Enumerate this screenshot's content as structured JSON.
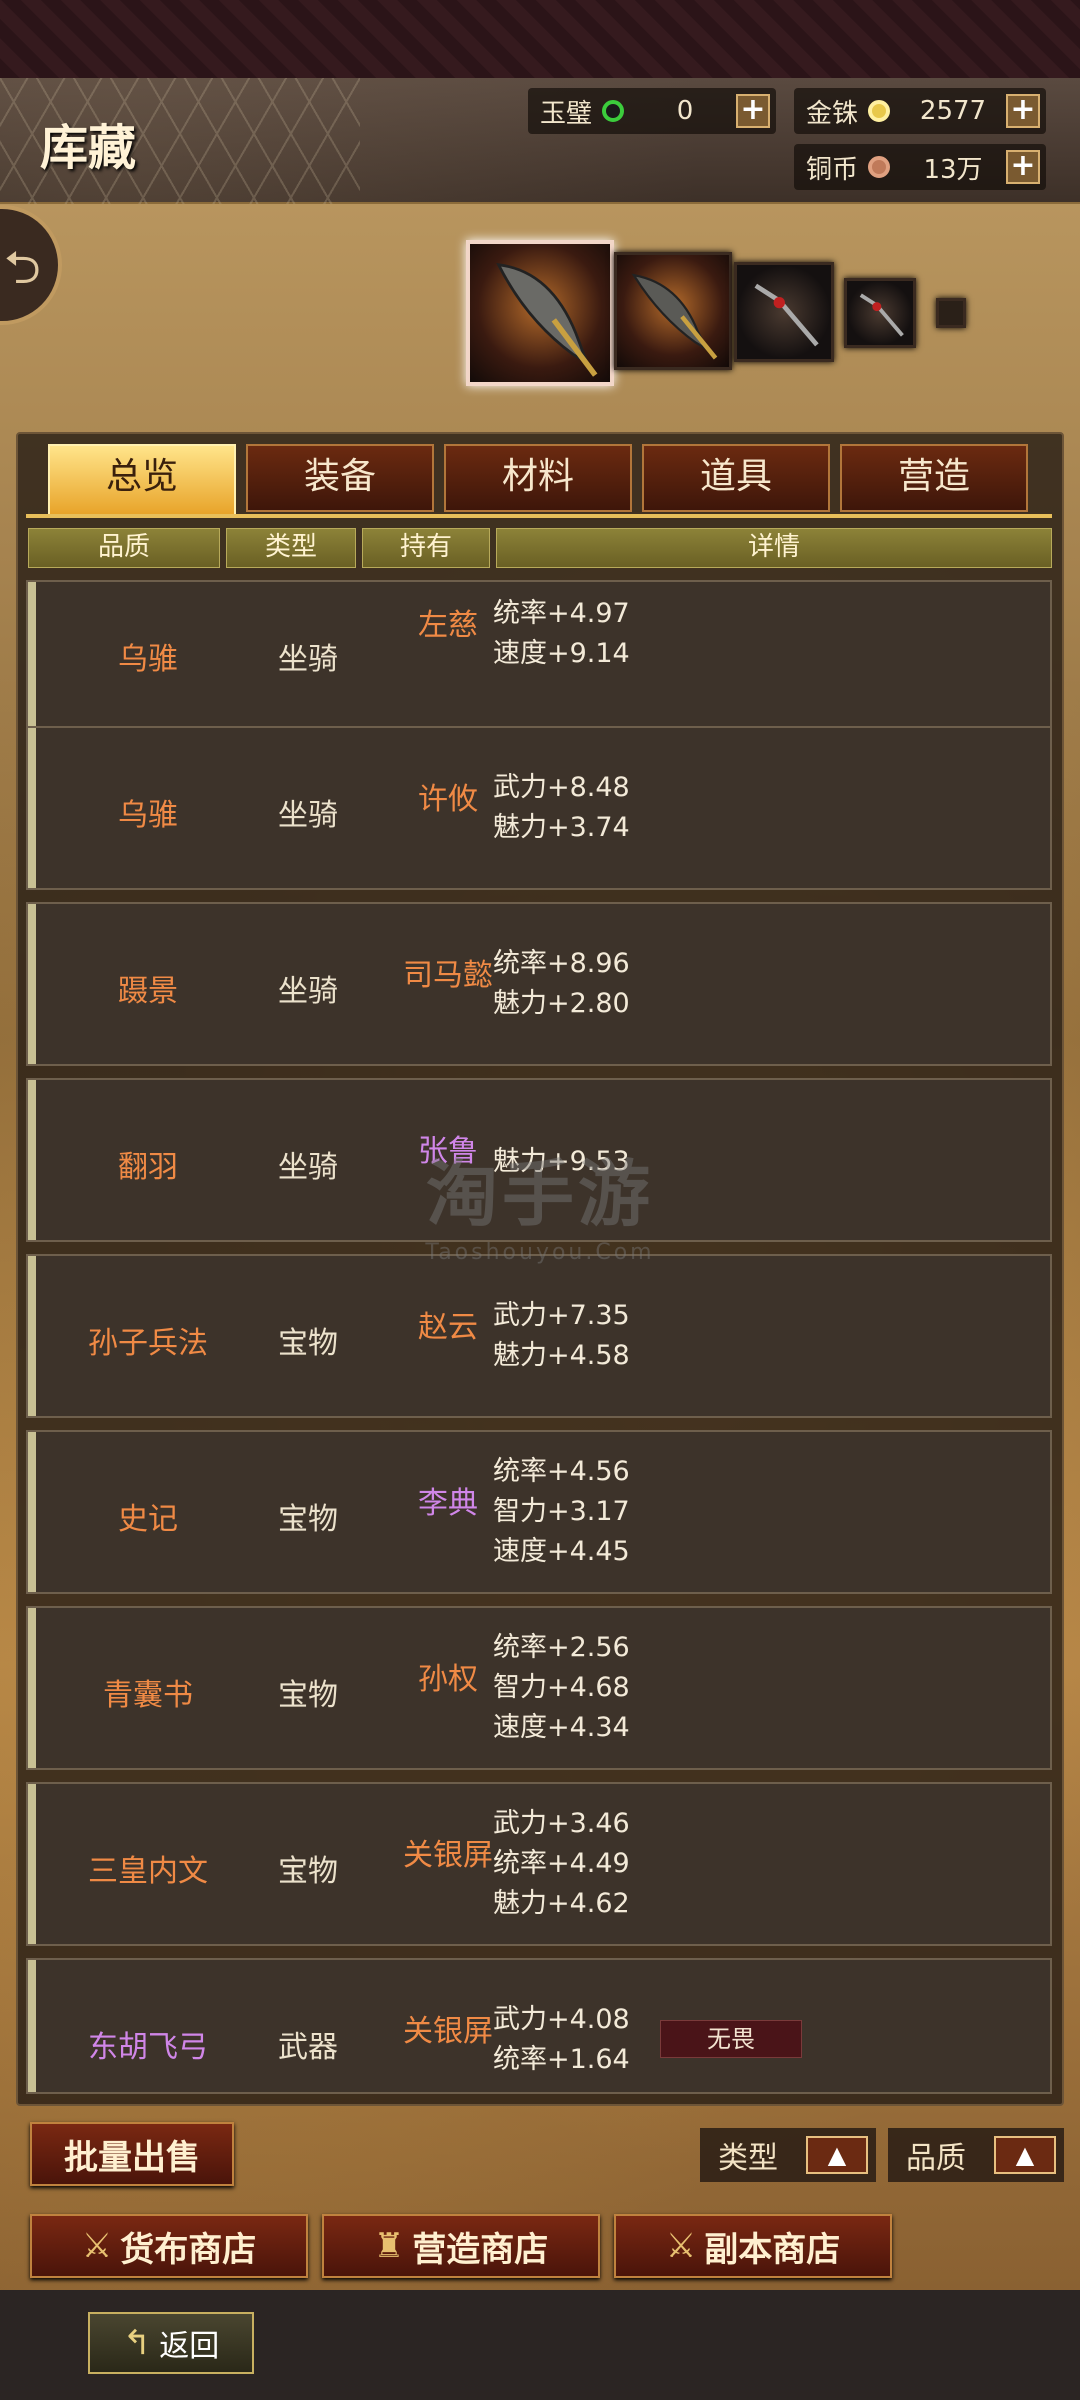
{
  "header": {
    "title": "库藏",
    "currencies": [
      {
        "name": "玉璧",
        "value": "0",
        "icon": "jade-icon",
        "color": "#3ccc3c"
      },
      {
        "name": "金铢",
        "value": "2577",
        "icon": "gold-coin-icon",
        "color": "#e8c84a"
      },
      {
        "name": "铜币",
        "value": "13万",
        "icon": "copper-coin-icon",
        "color": "#c07a5a"
      }
    ],
    "plus": "+"
  },
  "tabs": [
    {
      "label": "总览",
      "active": true
    },
    {
      "label": "装备",
      "active": false
    },
    {
      "label": "材料",
      "active": false
    },
    {
      "label": "道具",
      "active": false
    },
    {
      "label": "营造",
      "active": false
    }
  ],
  "columns": {
    "quality": "品质",
    "type": "类型",
    "holder": "持有",
    "details": "详情"
  },
  "rows": [
    {
      "name": "乌骓",
      "type": "坐骑",
      "holder": "左慈",
      "holder_color": "orange",
      "stats": [
        "统率+4.97",
        "速度+9.14"
      ]
    },
    {
      "name": "乌骓",
      "type": "坐骑",
      "holder": "许攸",
      "holder_color": "orange",
      "stats": [
        "武力+8.48",
        "魅力+3.74"
      ]
    },
    {
      "name": "蹑景",
      "type": "坐骑",
      "holder": "司马懿",
      "holder_color": "orange",
      "stats": [
        "统率+8.96",
        "魅力+2.80"
      ]
    },
    {
      "name": "翻羽",
      "type": "坐骑",
      "holder": "张鲁",
      "holder_color": "purple",
      "stats": [
        "魅力+9.53"
      ]
    },
    {
      "name": "孙子兵法",
      "type": "宝物",
      "holder": "赵云",
      "holder_color": "orange",
      "stats": [
        "武力+7.35",
        "魅力+4.58"
      ]
    },
    {
      "name": "史记",
      "type": "宝物",
      "holder": "李典",
      "holder_color": "purple",
      "stats": [
        "统率+4.56",
        "智力+3.17",
        "速度+4.45"
      ]
    },
    {
      "name": "青囊书",
      "type": "宝物",
      "holder": "孙权",
      "holder_color": "orange",
      "stats": [
        "统率+2.56",
        "智力+4.68",
        "速度+4.34"
      ]
    },
    {
      "name": "三皇内文",
      "type": "宝物",
      "holder": "关银屏",
      "holder_color": "orange",
      "stats": [
        "武力+3.46",
        "统率+4.49",
        "魅力+4.62"
      ]
    },
    {
      "name": "东胡飞弓",
      "type": "武器",
      "holder": "关银屏",
      "holder_color": "orange",
      "name_color": "purple",
      "stats": [
        "武力+4.08",
        "统率+1.64"
      ],
      "tag": "无畏"
    }
  ],
  "watermark": {
    "big": "淘手游",
    "small": "Taoshouyou.Com"
  },
  "buttons": {
    "bulk_sell": "批量出售",
    "sort_type": "类型",
    "sort_quality": "品质",
    "sort_arrow": "▲",
    "currency_shop": "货布商店",
    "build_shop": "营造商店",
    "dungeon_shop": "副本商店",
    "return": "返回"
  }
}
